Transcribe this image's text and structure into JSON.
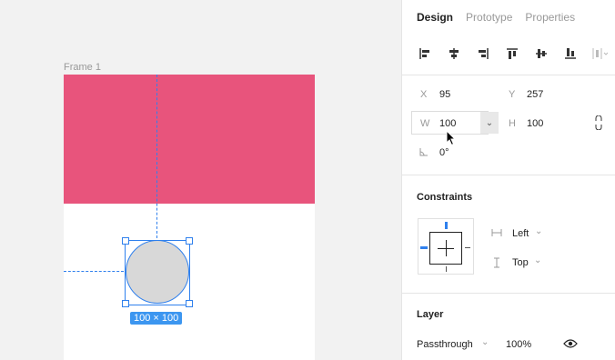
{
  "canvas": {
    "frame_label": "Frame 1",
    "size_badge": "100 × 100",
    "colors": {
      "pink": "#e8547c",
      "selection": "#2f80ed"
    }
  },
  "panel": {
    "tabs": [
      {
        "label": "Design",
        "active": true
      },
      {
        "label": "Prototype",
        "active": false
      },
      {
        "label": "Properties",
        "active": false
      }
    ],
    "align_icons": [
      "align-left-icon",
      "align-horizontal-center-icon",
      "align-right-icon",
      "align-top-icon",
      "align-vertical-center-icon",
      "align-bottom-icon",
      "distribute-icon"
    ],
    "position": {
      "x_label": "X",
      "x_value": "95",
      "y_label": "Y",
      "y_value": "257"
    },
    "size": {
      "w_label": "W",
      "w_value": "100",
      "h_label": "H",
      "h_value": "100"
    },
    "rotation": {
      "value": "0°"
    },
    "constraints": {
      "title": "Constraints",
      "horizontal": "Left",
      "vertical": "Top"
    },
    "layer": {
      "title": "Layer",
      "blend": "Passthrough",
      "opacity": "100%"
    }
  }
}
